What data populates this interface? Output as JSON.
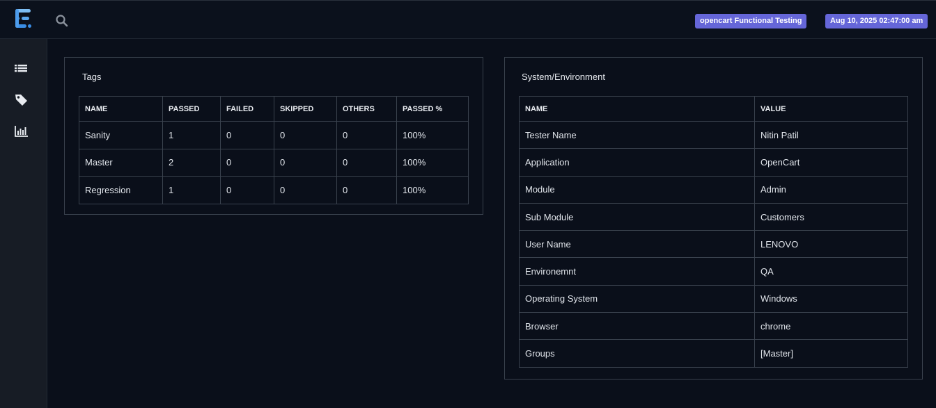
{
  "header": {
    "project_badge": "opencart Functional Testing",
    "date_badge": "Aug 10, 2025 02:47:00 am"
  },
  "sidebar": {
    "items": [
      {
        "icon": "list-icon"
      },
      {
        "icon": "tag-icon"
      },
      {
        "icon": "bar-chart-icon"
      }
    ]
  },
  "tags": {
    "title": "Tags",
    "columns": [
      "NAME",
      "PASSED",
      "FAILED",
      "SKIPPED",
      "OTHERS",
      "PASSED %"
    ],
    "rows": [
      [
        "Sanity",
        "1",
        "0",
        "0",
        "0",
        "100%"
      ],
      [
        "Master",
        "2",
        "0",
        "0",
        "0",
        "100%"
      ],
      [
        "Regression",
        "1",
        "0",
        "0",
        "0",
        "100%"
      ]
    ]
  },
  "environment": {
    "title": "System/Environment",
    "columns": [
      "NAME",
      "VALUE"
    ],
    "rows": [
      [
        "Tester Name",
        "Nitin Patil"
      ],
      [
        "Application",
        "OpenCart"
      ],
      [
        "Module",
        "Admin"
      ],
      [
        "Sub Module",
        "Customers"
      ],
      [
        "User Name",
        "LENOVO"
      ],
      [
        "Environemnt",
        "QA"
      ],
      [
        "Operating System",
        "Windows"
      ],
      [
        "Browser",
        "chrome"
      ],
      [
        "Groups",
        "[Master]"
      ]
    ]
  },
  "colors": {
    "background": "#0a0f1a",
    "sidebar": "#171c25",
    "badge": "#6566d8",
    "logo": "#3a8ee6"
  }
}
